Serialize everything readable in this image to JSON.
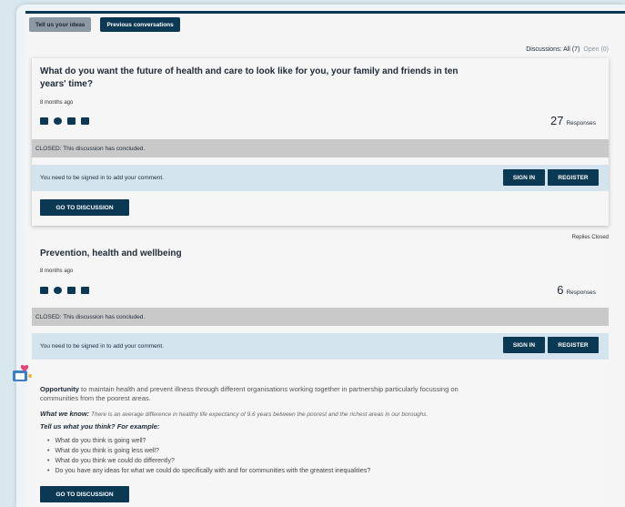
{
  "tabs": {
    "ideas_label": "Tell us your ideas",
    "previous_label": "Previous conversations"
  },
  "filter": {
    "all_label": "Discussions: All (7)",
    "open_label": "Open (0)"
  },
  "discussions": [
    {
      "title_line1": "What do you want the future of health and care to look like for you, your family and friends in ten",
      "title_line2": "years' time?",
      "date": "8 months ago",
      "responses_count": "27",
      "responses_label": "Responses",
      "closed_text": "CLOSED: This discussion has concluded.",
      "signin_text": "You need to be signed in to add your comment.",
      "signin_button": "SIGN IN",
      "register_button": "REGISTER",
      "go_button": "GO TO DISCUSSION"
    },
    {
      "title": "Prevention, health and wellbeing",
      "date": "8 months ago",
      "responses_count": "6",
      "responses_label": "Responses",
      "closed_text": "CLOSED: This discussion has concluded.",
      "signin_text": "You need to be signed in to add your comment.",
      "signin_button": "SIGN IN",
      "register_button": "REGISTER",
      "opportunity_label": "Opportunity",
      "opportunity_line1": " to maintain health and prevent illness through different organisations working together in partnership particularly focussing on",
      "opportunity_line2": "communities from the poorest areas.",
      "know_label": "What we know:",
      "know_text": " There is an average difference in healthy life expectancy of 9.6 years between the poorest and the richest areas in our boroughs.",
      "tell_label": "Tell us what you think? For example:",
      "questions": [
        "What do you think is going well?",
        "What do you think is going less well?",
        "What do you think we could do differently?",
        "Do you have any ideas for what we could do specifically with and for communities with the greatest inequalities?"
      ],
      "go_button": "GO TO DISCUSSION"
    }
  ],
  "replies_closed": "Replies Closed",
  "colors": {
    "accent": "#0b3954",
    "closed_bar": "#c9c9c9",
    "signin_bar": "#d3e4ef"
  },
  "icons": [
    "facebook-icon",
    "twitter-icon",
    "linkedin-icon",
    "email-icon",
    "opportunity-icon"
  ]
}
